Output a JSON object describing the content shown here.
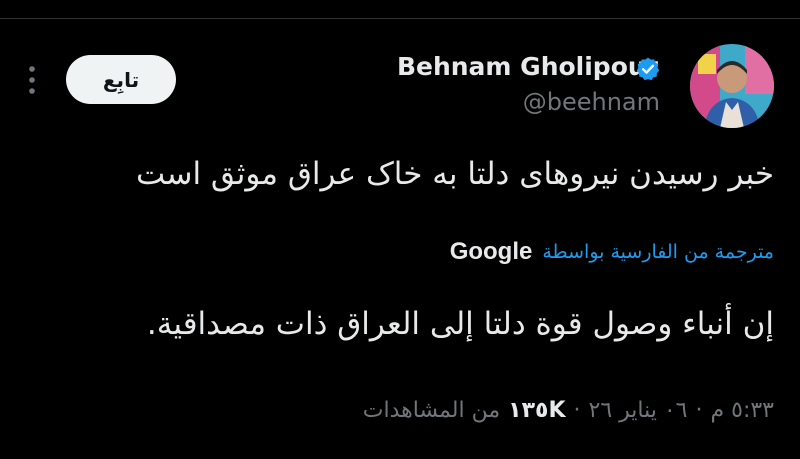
{
  "tweet": {
    "author": {
      "display_name": "Behnam Gholipour",
      "handle": "@beehnam",
      "verified": true,
      "verified_color": "#1d9bf0"
    },
    "follow_label": "تابِع",
    "text": "خبر رسیدن نیروهای دلتا به خاک عراق موثق است",
    "translation": {
      "label": "مترجمة من الفارسية بواسطة",
      "provider": "Google",
      "text": "إن أنباء وصول قوة دلتا إلى العراق ذات مصداقية."
    },
    "meta": {
      "time": "٥:٣٣ م",
      "separator": "·",
      "date": "٠٦ يناير ٢٦",
      "views_count": "١٣٥K",
      "views_label": "من المشاهدات"
    }
  },
  "colors": {
    "background": "#000000",
    "text_primary": "#e7e9ea",
    "text_secondary": "#71767b",
    "accent": "#1d9bf0",
    "button_bg": "#eff3f4"
  },
  "icons": {
    "more": "more-vertical-icon",
    "verified": "verified-badge-icon"
  }
}
